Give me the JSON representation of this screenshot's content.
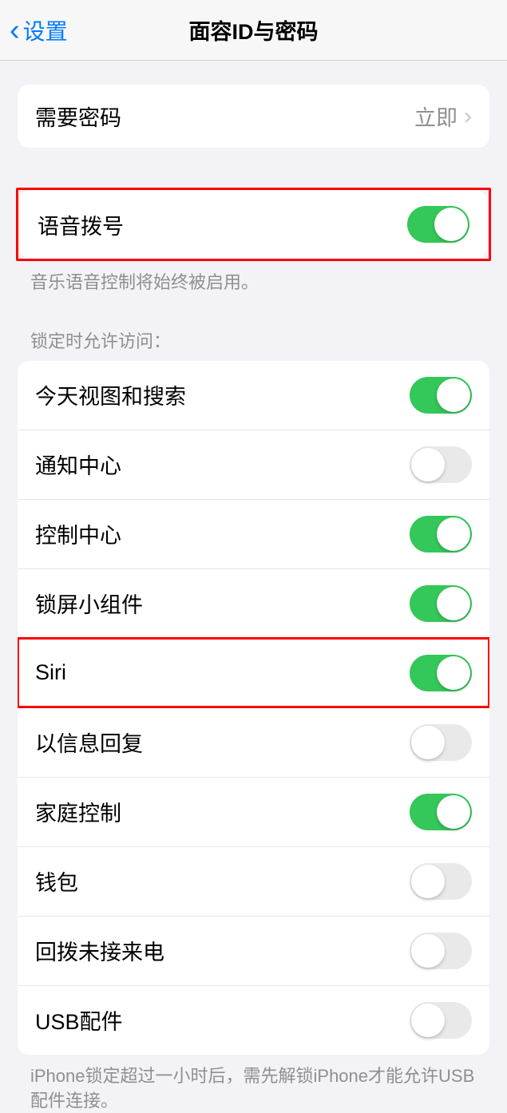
{
  "header": {
    "back_label": "设置",
    "title": "面容ID与密码"
  },
  "passcode_row": {
    "label": "需要密码",
    "value": "立即"
  },
  "voice_dial": {
    "label": "语音拨号",
    "footnote": "音乐语音控制将始终被启用。"
  },
  "lock_access": {
    "header": "锁定时允许访问：",
    "items": [
      {
        "label": "今天视图和搜索",
        "on": true
      },
      {
        "label": "通知中心",
        "on": false
      },
      {
        "label": "控制中心",
        "on": true
      },
      {
        "label": "锁屏小组件",
        "on": true
      },
      {
        "label": "Siri",
        "on": true
      },
      {
        "label": "以信息回复",
        "on": false
      },
      {
        "label": "家庭控制",
        "on": true
      },
      {
        "label": "钱包",
        "on": false
      },
      {
        "label": "回拨未接来电",
        "on": false
      },
      {
        "label": "USB配件",
        "on": false
      }
    ],
    "footnote": "iPhone锁定超过一小时后，需先解锁iPhone才能允许USB配件连接。"
  },
  "highlighted_rows": [
    0,
    5
  ]
}
